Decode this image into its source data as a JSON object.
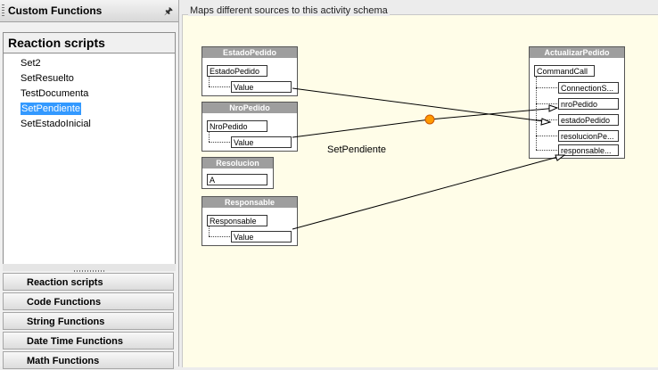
{
  "panel": {
    "title": "Custom Functions",
    "pin_icon": "pin-icon",
    "scripts_heading": "Reaction scripts",
    "scripts": [
      "Set2",
      "SetResuelto",
      "TestDocumenta",
      "SetPendiente",
      "SetEstadoInicial"
    ],
    "selected_script": "SetPendiente",
    "categories": [
      "Reaction scripts",
      "Code Functions",
      "String Functions",
      "Date Time Functions",
      "Math Functions"
    ]
  },
  "canvas": {
    "caption": "Maps different sources to this activity schema",
    "mapper_label": "SetPendiente",
    "sources": {
      "estado_pedido": {
        "title": "EstadoPedido",
        "field": "EstadoPedido",
        "child": "Value"
      },
      "nro_pedido": {
        "title": "NroPedido",
        "field": "NroPedido",
        "child": "Value"
      },
      "resolucion": {
        "title": "Resolucion",
        "field": "A"
      },
      "responsable": {
        "title": "Responsable",
        "field": "Responsable",
        "child": "Value"
      }
    },
    "target": {
      "title": "ActualizarPedido",
      "root": "CommandCall",
      "fields": [
        "ConnectionS...",
        "nroPedido",
        "estadoPedido",
        "resolucionPe...",
        "responsable..."
      ]
    }
  },
  "colors": {
    "selection": "#3399ff",
    "canvas_bg": "#fffde8",
    "node_title": "#9e9e9e",
    "mapper_dot": "#ff9900"
  }
}
